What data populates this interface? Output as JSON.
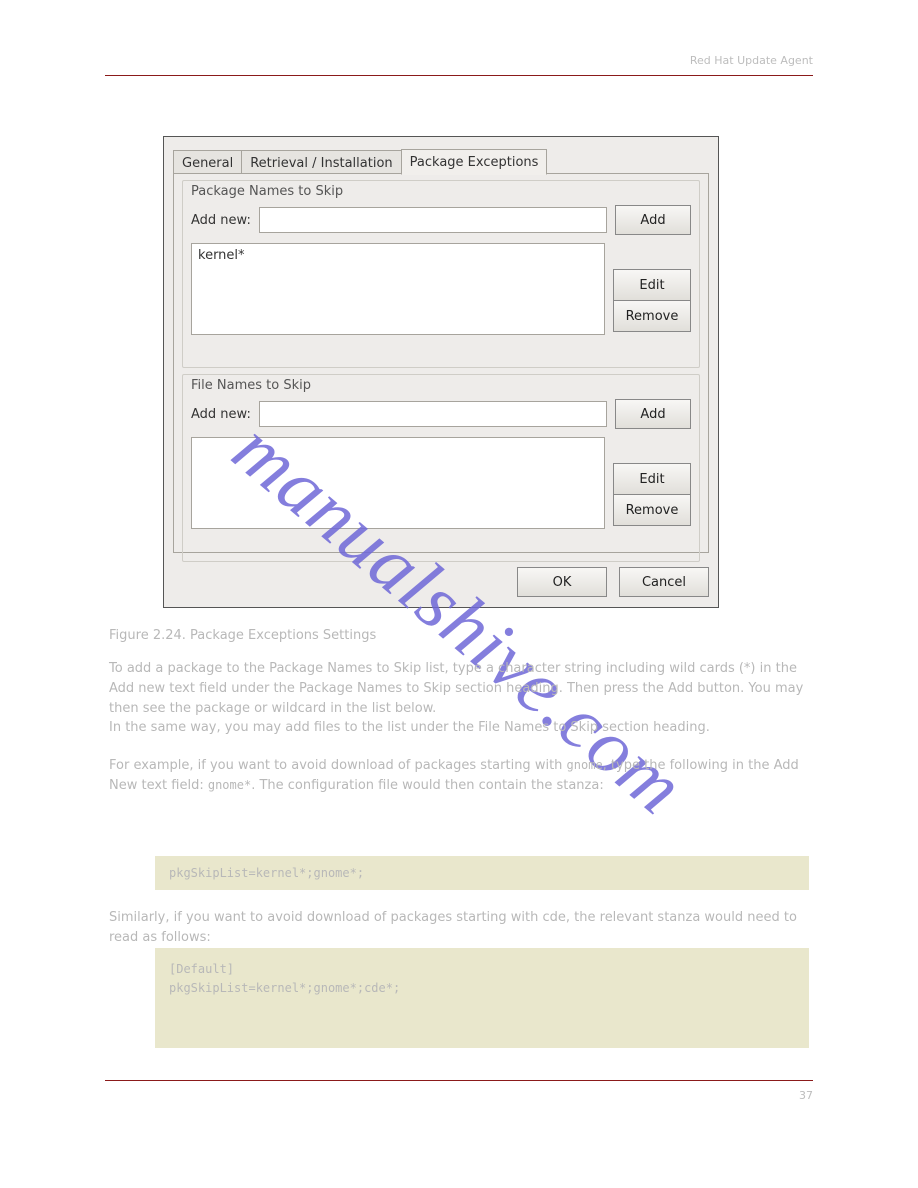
{
  "header": {
    "right_text": "Red Hat Update Agent"
  },
  "footer": {
    "left": "",
    "right": "37"
  },
  "dialog": {
    "tabs": [
      "General",
      "Retrieval / Installation",
      "Package Exceptions"
    ],
    "active_tab": 2,
    "fieldset1": {
      "legend": "Package Names to Skip",
      "add_label": "Add new:",
      "add_value": "",
      "add_button": "Add",
      "list_items": [
        "kernel*"
      ],
      "edit_button": "Edit",
      "remove_button": "Remove"
    },
    "fieldset2": {
      "legend": "File Names to Skip",
      "add_label": "Add new:",
      "add_value": "",
      "add_button": "Add",
      "list_items": [],
      "edit_button": "Edit",
      "remove_button": "Remove"
    },
    "ok_button": "OK",
    "cancel_button": "Cancel"
  },
  "caption": "Figure 2.24. Package Exceptions Settings",
  "para1": "To add a package to the Package Names to Skip list, type a character string including wild cards (*) in the Add new text field under the Package Names to Skip section heading. Then press the Add button. You may then see the package or wildcard in the list below.",
  "para2": "In the same way, you may add files to the list under the File Names to Skip section heading.",
  "para3_lead": "For example, if you want to avoid download of packages starting with ",
  "para3_code1": "gnome",
  "para3_mid": ", type the following in the Add New text field: ",
  "para3_code2": "gnome*",
  "para3_tail": ". The configuration file would then contain the stanza:",
  "code1": "pkgSkipList=kernel*;gnome*;",
  "para4": "Similarly, if you want to avoid download of packages starting with cde, the relevant stanza would need to read as follows:",
  "code2": "[Default]\npkgSkipList=kernel*;gnome*;cde*;",
  "watermark": "manualshive.com"
}
